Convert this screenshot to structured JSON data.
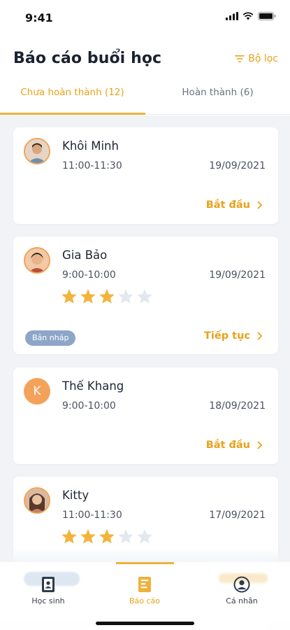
{
  "status_bar": {
    "time": "9:41"
  },
  "header": {
    "title": "Báo cáo buổi học",
    "filter_label": "Bộ lọc"
  },
  "tabs": [
    {
      "label": "Chưa hoàn thành (12)",
      "active": true
    },
    {
      "label": "Hoàn thành (6)",
      "active": false
    }
  ],
  "sessions": [
    {
      "name": "Khôi Minh",
      "time": "11:00-11:30",
      "date": "19/09/2021",
      "avatar": "photo-avatar",
      "rating": null,
      "badge": null,
      "action": "Bắt đầu"
    },
    {
      "name": "Gia Bảo",
      "time": "9:00-10:00",
      "date": "19/09/2021",
      "avatar": "photo-avatar",
      "rating": 3,
      "max_rating": 5,
      "badge": "Bản nháp",
      "action": "Tiếp tục"
    },
    {
      "name": "Thế Khang",
      "time": "9:00-10:00",
      "date": "18/09/2021",
      "avatar_letter": "K",
      "rating": null,
      "badge": null,
      "action": "Bắt đầu"
    },
    {
      "name": "Kitty",
      "time": "11:00-11:30",
      "date": "17/09/2021",
      "avatar": "photo-avatar",
      "rating": 3,
      "max_rating": 5,
      "badge": null,
      "action": null
    }
  ],
  "bottom_nav": [
    {
      "label": "Học sinh",
      "icon": "student-book-icon",
      "active": false
    },
    {
      "label": "Báo cáo",
      "icon": "report-icon",
      "active": true
    },
    {
      "label": "Cá nhân",
      "icon": "profile-icon",
      "active": false
    }
  ],
  "colors": {
    "accent": "#e8a21a",
    "badge": "#8da6c8",
    "star_filled": "#f2b43a",
    "star_empty": "#e3e7ee",
    "background": "#f1f3f7"
  }
}
